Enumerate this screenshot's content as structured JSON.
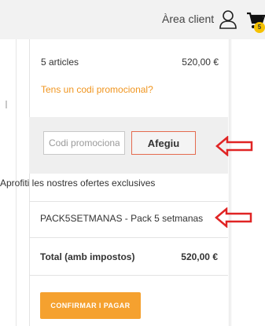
{
  "header": {
    "area_client_label": "Àrea client",
    "cart_count": "5",
    "icons": {
      "user": "user-outline-icon",
      "cart": "shopping-cart-icon"
    }
  },
  "summary": {
    "articles_label": "5 articles",
    "articles_price": "520,00 €",
    "promo_link": "Tens un codi promocional?"
  },
  "promo": {
    "input_placeholder": "Codi promocional",
    "input_value": "",
    "button_label": "Afegiu"
  },
  "offers": {
    "label": "Aprofiti les nostres ofertes exclusives",
    "items": [
      "PACK5SETMANAS - Pack 5 setmanas"
    ]
  },
  "total": {
    "label": "Total (amb impostos)",
    "price": "520,00 €"
  },
  "actions": {
    "confirm_label": "CONFIRMAR I PAGAR"
  },
  "colors": {
    "accent": "#f5a12f",
    "promo_link": "#f0951f",
    "annotation_arrow": "#e02424",
    "badge": "#f6c200"
  },
  "annotations": {
    "arrow_icon": "left-arrow-annotation-icon"
  }
}
